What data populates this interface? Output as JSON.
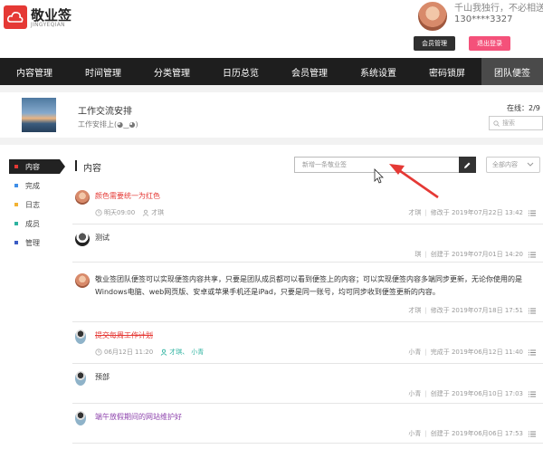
{
  "header": {
    "logo_name": "敬业签",
    "logo_sub": "JINGYEQIAN",
    "motto": "千山我独行，不必相送",
    "phone": "130****3327",
    "member_btn": "会员管理",
    "logout_btn": "退出登录",
    "accent": "#e53935"
  },
  "nav": {
    "items": [
      "内容管理",
      "时间管理",
      "分类管理",
      "日历总览",
      "会员管理",
      "系统设置",
      "密码锁屏",
      "团队便签"
    ],
    "active_index": 7
  },
  "team": {
    "title": "工作交流安排",
    "desc": "工作安排上(◕‿◕)",
    "online": "在线：2/9",
    "search_placeholder": "搜索"
  },
  "sidebar": {
    "items": [
      {
        "label": "内容",
        "color": "#e53935"
      },
      {
        "label": "完成",
        "color": "#3f8ee8"
      },
      {
        "label": "日志",
        "color": "#f2b233"
      },
      {
        "label": "成员",
        "color": "#2eb3a0"
      },
      {
        "label": "管理",
        "color": "#3b5cc4"
      }
    ]
  },
  "content": {
    "title": "内容",
    "new_placeholder": "新增一条敬业签",
    "filter_label": "全部内容",
    "notes": [
      {
        "text": "颜色需要统一为红色",
        "text_color": "#e53935",
        "remind": "明天09:00",
        "assignee": "才琪",
        "meta_name": "才琪",
        "meta_action": "修改于 2019年07月22日 13:42"
      },
      {
        "text": "测试",
        "text_color": "#333333",
        "meta_name": "琪",
        "meta_action": "创建于 2019年07月01日 14:20"
      },
      {
        "text": "敬业签团队便签可以实现便签内容共享，只要是团队成员都可以看到便签上的内容；可以实现便签内容多端同步更新，无论你使用的是Windows电脑、web网页版、安卓或苹果手机还是iPad，只要是同一账号，均可同步收到便签更新的内容。",
        "text_color": "#333333",
        "meta_name": "才琪",
        "meta_action": "修改于 2019年07月18日 17:51"
      },
      {
        "text": "提交每周工作计划",
        "text_color": "#e53935",
        "remind": "06月12日 11:20",
        "assignee_label": "才琪、",
        "assignee_done": "小青",
        "meta_name": "小青",
        "meta_action": "完成于 2019年06月12日 11:40"
      },
      {
        "text": "预部",
        "text_color": "#333333",
        "meta_name": "小青",
        "meta_action": "创建于 2019年06月10日 17:03"
      },
      {
        "text": "端午放假期间的网站维护好",
        "text_color": "#8e44ad",
        "meta_name": "小青",
        "meta_action": "创建于 2019年06月06日 17:53"
      }
    ]
  }
}
